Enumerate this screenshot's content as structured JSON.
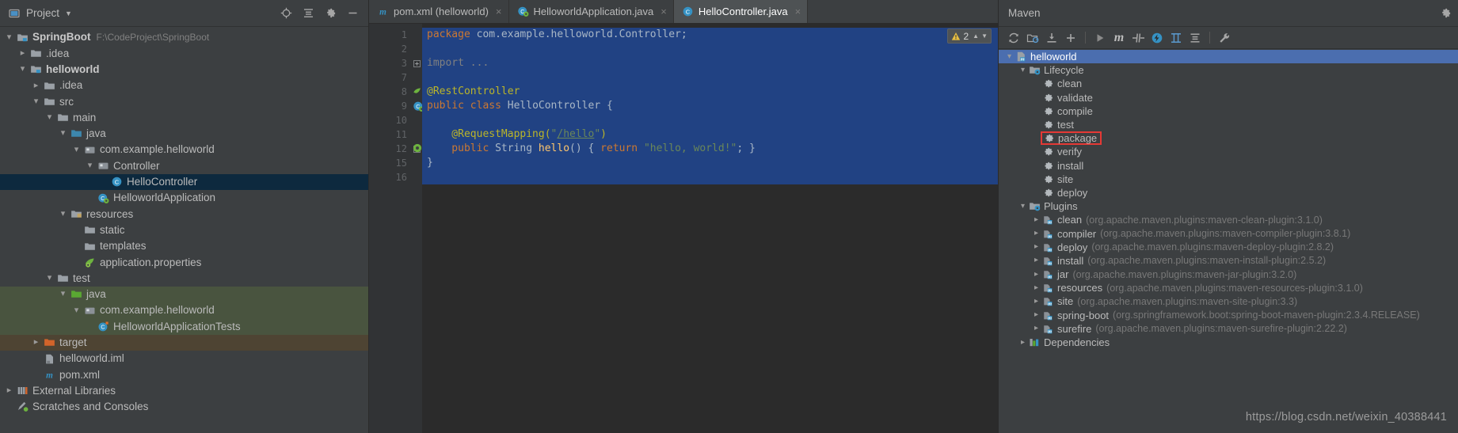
{
  "project_panel": {
    "title": "Project",
    "icons": [
      "project-view-icon",
      "target-icon",
      "collapse-all-icon",
      "settings-gear-icon",
      "hide-icon"
    ],
    "tree": [
      {
        "label": "SpringBoot",
        "sub": "F:\\CodeProject\\SpringBoot",
        "depth": 0,
        "twisty": "down",
        "icon": "module-folder-icon",
        "bold": true,
        "state": "normal"
      },
      {
        "label": ".idea",
        "sub": "",
        "depth": 1,
        "twisty": "right",
        "icon": "folder-icon",
        "bold": false,
        "state": "normal"
      },
      {
        "label": "helloworld",
        "sub": "",
        "depth": 1,
        "twisty": "down",
        "icon": "module-folder-icon",
        "bold": true,
        "state": "normal"
      },
      {
        "label": ".idea",
        "sub": "",
        "depth": 2,
        "twisty": "right",
        "icon": "folder-icon",
        "bold": false,
        "state": "normal"
      },
      {
        "label": "src",
        "sub": "",
        "depth": 2,
        "twisty": "down",
        "icon": "folder-icon",
        "bold": false,
        "state": "normal"
      },
      {
        "label": "main",
        "sub": "",
        "depth": 3,
        "twisty": "down",
        "icon": "folder-icon",
        "bold": false,
        "state": "normal"
      },
      {
        "label": "java",
        "sub": "",
        "depth": 4,
        "twisty": "down",
        "icon": "source-root-folder-icon",
        "bold": false,
        "state": "normal"
      },
      {
        "label": "com.example.helloworld",
        "sub": "",
        "depth": 5,
        "twisty": "down",
        "icon": "package-icon",
        "bold": false,
        "state": "normal"
      },
      {
        "label": "Controller",
        "sub": "",
        "depth": 6,
        "twisty": "down",
        "icon": "package-icon",
        "bold": false,
        "state": "normal"
      },
      {
        "label": "HelloController",
        "sub": "",
        "depth": 7,
        "twisty": "none",
        "icon": "java-class-icon",
        "bold": false,
        "state": "selected"
      },
      {
        "label": "HelloworldApplication",
        "sub": "",
        "depth": 6,
        "twisty": "none",
        "icon": "spring-class-icon",
        "bold": false,
        "state": "normal"
      },
      {
        "label": "resources",
        "sub": "",
        "depth": 4,
        "twisty": "down",
        "icon": "resources-folder-icon",
        "bold": false,
        "state": "normal"
      },
      {
        "label": "static",
        "sub": "",
        "depth": 5,
        "twisty": "none",
        "icon": "folder-icon",
        "bold": false,
        "state": "normal"
      },
      {
        "label": "templates",
        "sub": "",
        "depth": 5,
        "twisty": "none",
        "icon": "folder-icon",
        "bold": false,
        "state": "normal"
      },
      {
        "label": "application.properties",
        "sub": "",
        "depth": 5,
        "twisty": "none",
        "icon": "spring-properties-icon",
        "bold": false,
        "state": "normal"
      },
      {
        "label": "test",
        "sub": "",
        "depth": 3,
        "twisty": "down",
        "icon": "folder-icon",
        "bold": false,
        "state": "normal"
      },
      {
        "label": "java",
        "sub": "",
        "depth": 4,
        "twisty": "down",
        "icon": "test-source-root-icon",
        "bold": false,
        "state": "test-highlight"
      },
      {
        "label": "com.example.helloworld",
        "sub": "",
        "depth": 5,
        "twisty": "down",
        "icon": "package-icon",
        "bold": false,
        "state": "test-highlight"
      },
      {
        "label": "HelloworldApplicationTests",
        "sub": "",
        "depth": 6,
        "twisty": "none",
        "icon": "test-class-icon",
        "bold": false,
        "state": "test-highlight"
      },
      {
        "label": "target",
        "sub": "",
        "depth": 2,
        "twisty": "right",
        "icon": "target-folder-icon",
        "bold": false,
        "state": "target-highlight"
      },
      {
        "label": "helloworld.iml",
        "sub": "",
        "depth": 2,
        "twisty": "none",
        "icon": "iml-file-icon",
        "bold": false,
        "state": "normal"
      },
      {
        "label": "pom.xml",
        "sub": "",
        "depth": 2,
        "twisty": "none",
        "icon": "maven-pom-icon",
        "bold": false,
        "state": "normal"
      },
      {
        "label": "External Libraries",
        "sub": "",
        "depth": 0,
        "twisty": "right",
        "icon": "external-libraries-icon",
        "bold": false,
        "state": "normal"
      },
      {
        "label": "Scratches and Consoles",
        "sub": "",
        "depth": 0,
        "twisty": "none",
        "icon": "scratches-icon",
        "bold": false,
        "state": "normal"
      }
    ]
  },
  "editor": {
    "tabs": [
      {
        "label": "pom.xml (helloworld)",
        "icon": "maven-pom-icon",
        "active": false,
        "close": "×"
      },
      {
        "label": "HelloworldApplication.java",
        "icon": "spring-class-icon",
        "active": false,
        "close": "×"
      },
      {
        "label": "HelloController.java",
        "icon": "java-class-icon",
        "active": true,
        "close": "×"
      }
    ],
    "warning_badge": {
      "icon": "warning-triangle-icon",
      "count": "2",
      "chevron_up": "▲",
      "chevron_down": "▼"
    },
    "line_numbers": [
      "1",
      "2",
      "3",
      "7",
      "8",
      "9",
      "10",
      "11",
      "12",
      "15",
      "16"
    ],
    "gutter_marks": [
      "",
      "",
      "",
      "",
      "spring-bean-icon",
      "spring-class-icon",
      "",
      "",
      "spring-mapping-icon",
      "",
      ""
    ],
    "code_lines": [
      {
        "n": "1",
        "tokens": [
          {
            "t": "package",
            "c": "kw"
          },
          {
            "t": " com.example.helloworld.Controller;",
            "c": "pl"
          }
        ]
      },
      {
        "n": "2",
        "tokens": []
      },
      {
        "n": "3",
        "tokens": [
          {
            "t": "import ...",
            "c": "cmt"
          }
        ],
        "fold": true
      },
      {
        "n": "7",
        "tokens": []
      },
      {
        "n": "8",
        "tokens": [
          {
            "t": "@RestController",
            "c": "ann"
          }
        ]
      },
      {
        "n": "9",
        "tokens": [
          {
            "t": "public ",
            "c": "kw"
          },
          {
            "t": "class ",
            "c": "kw"
          },
          {
            "t": "HelloController {",
            "c": "pl"
          }
        ]
      },
      {
        "n": "10",
        "tokens": []
      },
      {
        "n": "11",
        "tokens": [
          {
            "t": "    @RequestMapping(",
            "c": "ann"
          },
          {
            "t": "\"",
            "c": "str"
          },
          {
            "t": "/hello",
            "c": "lnk"
          },
          {
            "t": "\"",
            "c": "str"
          },
          {
            "t": ")",
            "c": "ann"
          }
        ]
      },
      {
        "n": "12",
        "tokens": [
          {
            "t": "    public ",
            "c": "kw"
          },
          {
            "t": "String ",
            "c": "pl"
          },
          {
            "t": "hello",
            "c": "idn"
          },
          {
            "t": "() { ",
            "c": "pl"
          },
          {
            "t": "return ",
            "c": "kw"
          },
          {
            "t": "\"hello, world!\"",
            "c": "str"
          },
          {
            "t": "; }",
            "c": "pl"
          }
        ],
        "fold": true
      },
      {
        "n": "15",
        "tokens": [
          {
            "t": "}",
            "c": "pl"
          }
        ]
      },
      {
        "n": "16",
        "tokens": []
      }
    ]
  },
  "maven_panel": {
    "title": "Maven",
    "settings_icon": "gear-icon",
    "toolbar": [
      {
        "name": "reload-all-maven-projects-icon",
        "glyph": "⟳"
      },
      {
        "name": "generate-sources-icon",
        "glyph": ""
      },
      {
        "name": "download-sources-icon",
        "glyph": ""
      },
      {
        "name": "add-maven-project-icon",
        "glyph": "+"
      },
      {
        "name": "run-icon",
        "glyph": "▶"
      },
      {
        "name": "execute-maven-goal-icon",
        "glyph": "m"
      },
      {
        "name": "toggle-skip-tests-icon",
        "glyph": ""
      },
      {
        "name": "toggle-offline-mode-icon",
        "glyph": ""
      },
      {
        "name": "show-dependencies-icon",
        "glyph": ""
      },
      {
        "name": "collapse-all-icon",
        "glyph": ""
      },
      {
        "name": "maven-settings-icon",
        "glyph": ""
      }
    ],
    "tree": [
      {
        "label": "helloworld",
        "coord": "",
        "depth": 0,
        "twisty": "down",
        "icon": "maven-project-icon",
        "state": "selected",
        "boxed": false
      },
      {
        "label": "Lifecycle",
        "coord": "",
        "depth": 1,
        "twisty": "down",
        "icon": "lifecycle-folder-icon",
        "state": "normal",
        "boxed": false
      },
      {
        "label": "clean",
        "coord": "",
        "depth": 2,
        "twisty": "none",
        "icon": "maven-goal-icon",
        "state": "normal",
        "boxed": false
      },
      {
        "label": "validate",
        "coord": "",
        "depth": 2,
        "twisty": "none",
        "icon": "maven-goal-icon",
        "state": "normal",
        "boxed": false
      },
      {
        "label": "compile",
        "coord": "",
        "depth": 2,
        "twisty": "none",
        "icon": "maven-goal-icon",
        "state": "normal",
        "boxed": false
      },
      {
        "label": "test",
        "coord": "",
        "depth": 2,
        "twisty": "none",
        "icon": "maven-goal-icon",
        "state": "normal",
        "boxed": false
      },
      {
        "label": "package",
        "coord": "",
        "depth": 2,
        "twisty": "none",
        "icon": "maven-goal-icon",
        "state": "normal",
        "boxed": true
      },
      {
        "label": "verify",
        "coord": "",
        "depth": 2,
        "twisty": "none",
        "icon": "maven-goal-icon",
        "state": "normal",
        "boxed": false
      },
      {
        "label": "install",
        "coord": "",
        "depth": 2,
        "twisty": "none",
        "icon": "maven-goal-icon",
        "state": "normal",
        "boxed": false
      },
      {
        "label": "site",
        "coord": "",
        "depth": 2,
        "twisty": "none",
        "icon": "maven-goal-icon",
        "state": "normal",
        "boxed": false
      },
      {
        "label": "deploy",
        "coord": "",
        "depth": 2,
        "twisty": "none",
        "icon": "maven-goal-icon",
        "state": "normal",
        "boxed": false
      },
      {
        "label": "Plugins",
        "coord": "",
        "depth": 1,
        "twisty": "down",
        "icon": "plugins-folder-icon",
        "state": "normal",
        "boxed": false
      },
      {
        "label": "clean",
        "coord": "(org.apache.maven.plugins:maven-clean-plugin:3.1.0)",
        "depth": 2,
        "twisty": "right",
        "icon": "maven-plugin-icon",
        "state": "normal",
        "boxed": false
      },
      {
        "label": "compiler",
        "coord": "(org.apache.maven.plugins:maven-compiler-plugin:3.8.1)",
        "depth": 2,
        "twisty": "right",
        "icon": "maven-plugin-icon",
        "state": "normal",
        "boxed": false
      },
      {
        "label": "deploy",
        "coord": "(org.apache.maven.plugins:maven-deploy-plugin:2.8.2)",
        "depth": 2,
        "twisty": "right",
        "icon": "maven-plugin-icon",
        "state": "normal",
        "boxed": false
      },
      {
        "label": "install",
        "coord": "(org.apache.maven.plugins:maven-install-plugin:2.5.2)",
        "depth": 2,
        "twisty": "right",
        "icon": "maven-plugin-icon",
        "state": "normal",
        "boxed": false
      },
      {
        "label": "jar",
        "coord": "(org.apache.maven.plugins:maven-jar-plugin:3.2.0)",
        "depth": 2,
        "twisty": "right",
        "icon": "maven-plugin-icon",
        "state": "normal",
        "boxed": false
      },
      {
        "label": "resources",
        "coord": "(org.apache.maven.plugins:maven-resources-plugin:3.1.0)",
        "depth": 2,
        "twisty": "right",
        "icon": "maven-plugin-icon",
        "state": "normal",
        "boxed": false
      },
      {
        "label": "site",
        "coord": "(org.apache.maven.plugins:maven-site-plugin:3.3)",
        "depth": 2,
        "twisty": "right",
        "icon": "maven-plugin-icon",
        "state": "normal",
        "boxed": false
      },
      {
        "label": "spring-boot",
        "coord": "(org.springframework.boot:spring-boot-maven-plugin:2.3.4.RELEASE)",
        "depth": 2,
        "twisty": "right",
        "icon": "maven-plugin-icon",
        "state": "normal",
        "boxed": false
      },
      {
        "label": "surefire",
        "coord": "(org.apache.maven.plugins:maven-surefire-plugin:2.22.2)",
        "depth": 2,
        "twisty": "right",
        "icon": "maven-plugin-icon",
        "state": "normal",
        "boxed": false
      },
      {
        "label": "Dependencies",
        "coord": "",
        "depth": 1,
        "twisty": "right",
        "icon": "dependencies-icon",
        "state": "normal",
        "boxed": false
      }
    ]
  },
  "watermark": "https://blog.csdn.net/weixin_40388441",
  "colors": {
    "panel_bg": "#3c3f41",
    "editor_bg": "#2b2b2b",
    "selection_blue": "#214283",
    "tree_selection": "#0d293e",
    "maven_selection": "#4b6eaf",
    "test_highlight": "#49543f",
    "target_highlight": "#4e4433",
    "annotation_red": "#e53935",
    "accent_cyan": "#3592c4"
  }
}
